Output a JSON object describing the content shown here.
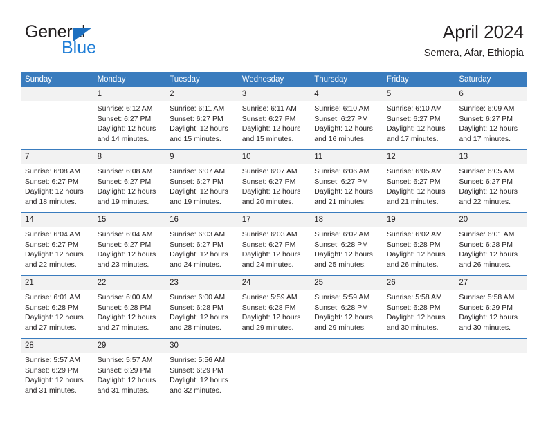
{
  "brand": {
    "name_top": "General",
    "name_bottom": "Blue"
  },
  "header": {
    "title": "April 2024",
    "subtitle": "Semera, Afar, Ethiopia"
  },
  "colors": {
    "header_blue": "#3a7cbe",
    "brand_blue": "#1c7cd6",
    "daynum_band": "#f2f2f2",
    "text": "#231f20"
  },
  "weekday_headers": [
    "Sunday",
    "Monday",
    "Tuesday",
    "Wednesday",
    "Thursday",
    "Friday",
    "Saturday"
  ],
  "weeks": [
    [
      {
        "day": "",
        "empty": true
      },
      {
        "day": "1",
        "sunrise": "Sunrise: 6:12 AM",
        "sunset": "Sunset: 6:27 PM",
        "daylight": "Daylight: 12 hours and 14 minutes."
      },
      {
        "day": "2",
        "sunrise": "Sunrise: 6:11 AM",
        "sunset": "Sunset: 6:27 PM",
        "daylight": "Daylight: 12 hours and 15 minutes."
      },
      {
        "day": "3",
        "sunrise": "Sunrise: 6:11 AM",
        "sunset": "Sunset: 6:27 PM",
        "daylight": "Daylight: 12 hours and 15 minutes."
      },
      {
        "day": "4",
        "sunrise": "Sunrise: 6:10 AM",
        "sunset": "Sunset: 6:27 PM",
        "daylight": "Daylight: 12 hours and 16 minutes."
      },
      {
        "day": "5",
        "sunrise": "Sunrise: 6:10 AM",
        "sunset": "Sunset: 6:27 PM",
        "daylight": "Daylight: 12 hours and 17 minutes."
      },
      {
        "day": "6",
        "sunrise": "Sunrise: 6:09 AM",
        "sunset": "Sunset: 6:27 PM",
        "daylight": "Daylight: 12 hours and 17 minutes."
      }
    ],
    [
      {
        "day": "7",
        "sunrise": "Sunrise: 6:08 AM",
        "sunset": "Sunset: 6:27 PM",
        "daylight": "Daylight: 12 hours and 18 minutes."
      },
      {
        "day": "8",
        "sunrise": "Sunrise: 6:08 AM",
        "sunset": "Sunset: 6:27 PM",
        "daylight": "Daylight: 12 hours and 19 minutes."
      },
      {
        "day": "9",
        "sunrise": "Sunrise: 6:07 AM",
        "sunset": "Sunset: 6:27 PM",
        "daylight": "Daylight: 12 hours and 19 minutes."
      },
      {
        "day": "10",
        "sunrise": "Sunrise: 6:07 AM",
        "sunset": "Sunset: 6:27 PM",
        "daylight": "Daylight: 12 hours and 20 minutes."
      },
      {
        "day": "11",
        "sunrise": "Sunrise: 6:06 AM",
        "sunset": "Sunset: 6:27 PM",
        "daylight": "Daylight: 12 hours and 21 minutes."
      },
      {
        "day": "12",
        "sunrise": "Sunrise: 6:05 AM",
        "sunset": "Sunset: 6:27 PM",
        "daylight": "Daylight: 12 hours and 21 minutes."
      },
      {
        "day": "13",
        "sunrise": "Sunrise: 6:05 AM",
        "sunset": "Sunset: 6:27 PM",
        "daylight": "Daylight: 12 hours and 22 minutes."
      }
    ],
    [
      {
        "day": "14",
        "sunrise": "Sunrise: 6:04 AM",
        "sunset": "Sunset: 6:27 PM",
        "daylight": "Daylight: 12 hours and 22 minutes."
      },
      {
        "day": "15",
        "sunrise": "Sunrise: 6:04 AM",
        "sunset": "Sunset: 6:27 PM",
        "daylight": "Daylight: 12 hours and 23 minutes."
      },
      {
        "day": "16",
        "sunrise": "Sunrise: 6:03 AM",
        "sunset": "Sunset: 6:27 PM",
        "daylight": "Daylight: 12 hours and 24 minutes."
      },
      {
        "day": "17",
        "sunrise": "Sunrise: 6:03 AM",
        "sunset": "Sunset: 6:27 PM",
        "daylight": "Daylight: 12 hours and 24 minutes."
      },
      {
        "day": "18",
        "sunrise": "Sunrise: 6:02 AM",
        "sunset": "Sunset: 6:28 PM",
        "daylight": "Daylight: 12 hours and 25 minutes."
      },
      {
        "day": "19",
        "sunrise": "Sunrise: 6:02 AM",
        "sunset": "Sunset: 6:28 PM",
        "daylight": "Daylight: 12 hours and 26 minutes."
      },
      {
        "day": "20",
        "sunrise": "Sunrise: 6:01 AM",
        "sunset": "Sunset: 6:28 PM",
        "daylight": "Daylight: 12 hours and 26 minutes."
      }
    ],
    [
      {
        "day": "21",
        "sunrise": "Sunrise: 6:01 AM",
        "sunset": "Sunset: 6:28 PM",
        "daylight": "Daylight: 12 hours and 27 minutes."
      },
      {
        "day": "22",
        "sunrise": "Sunrise: 6:00 AM",
        "sunset": "Sunset: 6:28 PM",
        "daylight": "Daylight: 12 hours and 27 minutes."
      },
      {
        "day": "23",
        "sunrise": "Sunrise: 6:00 AM",
        "sunset": "Sunset: 6:28 PM",
        "daylight": "Daylight: 12 hours and 28 minutes."
      },
      {
        "day": "24",
        "sunrise": "Sunrise: 5:59 AM",
        "sunset": "Sunset: 6:28 PM",
        "daylight": "Daylight: 12 hours and 29 minutes."
      },
      {
        "day": "25",
        "sunrise": "Sunrise: 5:59 AM",
        "sunset": "Sunset: 6:28 PM",
        "daylight": "Daylight: 12 hours and 29 minutes."
      },
      {
        "day": "26",
        "sunrise": "Sunrise: 5:58 AM",
        "sunset": "Sunset: 6:28 PM",
        "daylight": "Daylight: 12 hours and 30 minutes."
      },
      {
        "day": "27",
        "sunrise": "Sunrise: 5:58 AM",
        "sunset": "Sunset: 6:29 PM",
        "daylight": "Daylight: 12 hours and 30 minutes."
      }
    ],
    [
      {
        "day": "28",
        "sunrise": "Sunrise: 5:57 AM",
        "sunset": "Sunset: 6:29 PM",
        "daylight": "Daylight: 12 hours and 31 minutes."
      },
      {
        "day": "29",
        "sunrise": "Sunrise: 5:57 AM",
        "sunset": "Sunset: 6:29 PM",
        "daylight": "Daylight: 12 hours and 31 minutes."
      },
      {
        "day": "30",
        "sunrise": "Sunrise: 5:56 AM",
        "sunset": "Sunset: 6:29 PM",
        "daylight": "Daylight: 12 hours and 32 minutes."
      },
      {
        "day": "",
        "empty": true
      },
      {
        "day": "",
        "empty": true
      },
      {
        "day": "",
        "empty": true
      },
      {
        "day": "",
        "empty": true
      }
    ]
  ]
}
